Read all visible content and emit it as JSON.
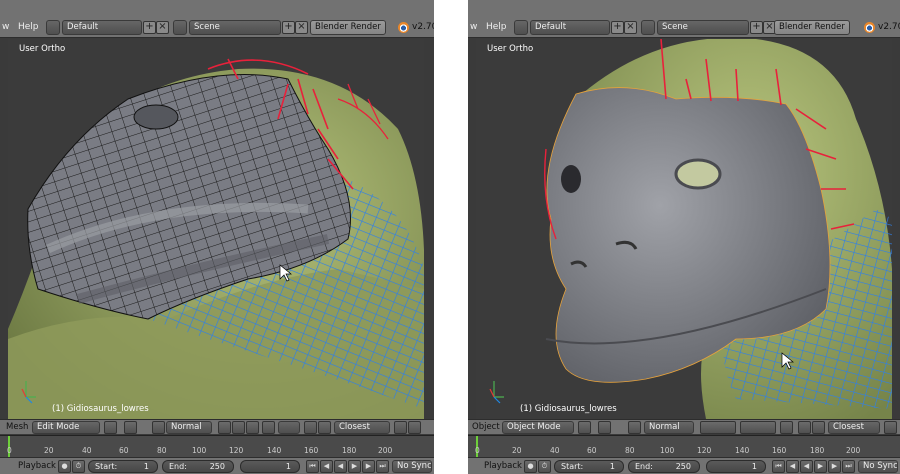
{
  "left": {
    "menu": {
      "file_partial": "w",
      "help": "Help"
    },
    "layout": "Default",
    "scene": "Scene",
    "engine": "Blender Render",
    "version": "v2.70",
    "view_label": "User Ortho",
    "object_label": "(1) Gidiosaurus_lowres",
    "header3d": {
      "menu": "Mesh",
      "mode": "Edit Mode",
      "shading_pivot": "Normal",
      "snap": "Closest"
    },
    "timeline_ticks": [
      "0",
      "20",
      "40",
      "60",
      "80",
      "100",
      "120",
      "140",
      "160",
      "180",
      "200"
    ],
    "playback": {
      "label": "Playback",
      "start_label": "Start:",
      "start": "1",
      "end_label": "End:",
      "end": "250",
      "frame": "1",
      "sync": "No Sync"
    }
  },
  "right": {
    "menu": {
      "file_partial": "w",
      "help": "Help"
    },
    "layout": "Default",
    "scene": "Scene",
    "engine": "Blender Render",
    "version": "v2.70",
    "view_label": "User Ortho",
    "object_label": "(1) Gidiosaurus_lowres",
    "header3d": {
      "menu": "Object",
      "mode": "Object Mode",
      "shading_pivot": "Normal",
      "snap": "Closest"
    },
    "timeline_ticks": [
      "0",
      "20",
      "40",
      "60",
      "80",
      "100",
      "120",
      "140",
      "160",
      "180",
      "200"
    ],
    "playback": {
      "label": "Playback",
      "start_label": "Start:",
      "start": "1",
      "end_label": "End:",
      "end": "250",
      "frame": "1",
      "sync": "No Sync"
    }
  },
  "colors": {
    "header": "#727272",
    "viewport": "#3b3b3b",
    "sculpt_green": "#a6b56a",
    "mesh_gray": "#7d7f86",
    "seam_red": "#e8213b",
    "wire_blue": "#2f7fe8",
    "frame_cursor": "#6ecf3a"
  }
}
